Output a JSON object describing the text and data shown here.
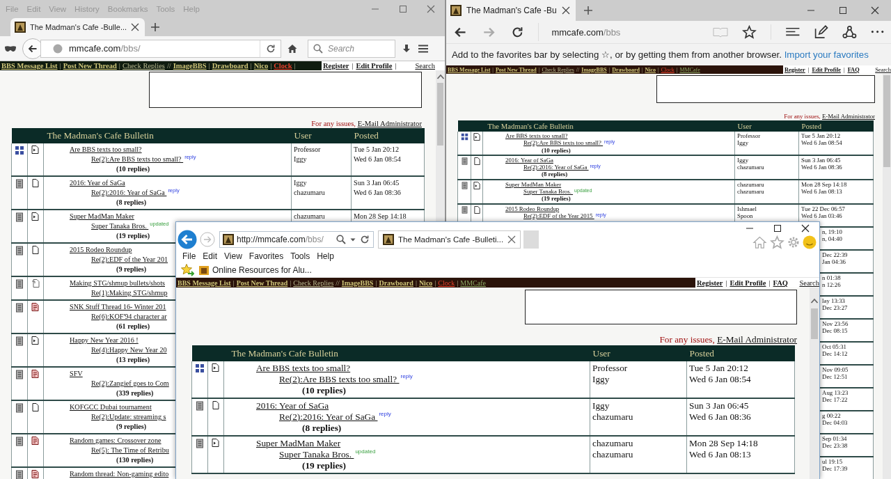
{
  "windows": [
    {
      "kind": "firefox",
      "menu": [
        "File",
        "Edit",
        "View",
        "History",
        "Bookmarks",
        "Tools",
        "Help"
      ],
      "tabs": [
        {
          "title": "The Madman's Cafe -Bulle...",
          "selected": true
        }
      ],
      "address": {
        "host": "mmcafe.com",
        "path": "/bbs/"
      },
      "search": {
        "placeholder": "Search"
      },
      "page": {
        "nav": [
          {
            "kind": "link",
            "text": "BBS Message List",
            "bold": true
          },
          {
            "kind": "sep",
            "text": "|"
          },
          {
            "kind": "link",
            "text": "Post New Thread",
            "bold": true
          },
          {
            "kind": "sep",
            "text": "|"
          },
          {
            "kind": "link",
            "text": "Check Replies",
            "bold": false
          },
          {
            "kind": "sep",
            "text": "//"
          },
          {
            "kind": "link",
            "text": "ImageBBS",
            "bold": true
          },
          {
            "kind": "sep",
            "text": "|"
          },
          {
            "kind": "link",
            "text": "Drawboard",
            "bold": true
          },
          {
            "kind": "sep",
            "text": "|"
          },
          {
            "kind": "link",
            "text": "Nico",
            "bold": true
          },
          {
            "kind": "sep",
            "text": "|"
          },
          {
            "kind": "alert",
            "text": "Clock",
            "bold": true
          },
          {
            "kind": "sep",
            "text": "|"
          }
        ],
        "account": [
          {
            "kind": "link",
            "text": "Register"
          },
          {
            "kind": "sep",
            "text": "|"
          },
          {
            "kind": "link",
            "text": "Edit Profile"
          },
          {
            "kind": "sep",
            "text": "|"
          }
        ],
        "search_link": "Search",
        "notice": {
          "text": "For any issues,",
          "link": "E-Mail Administrator"
        },
        "table": {
          "columns": [
            "The Madman's Cafe Bulletin",
            "User",
            "Posted"
          ],
          "rows": [
            {
              "kind": "sticky",
              "status": {
                "kind": "unread"
              },
              "title": "Are BBS texts too small?",
              "last": "Re(2):Are BBS texts too small? $^{reply}$",
              "tag": {
                "kind": "reply"
              },
              "replies": "(10 replies)",
              "users": [
                "Professor",
                "Iggy"
              ],
              "posted": [
                "Tue 5 Jan 20:12",
                "Wed 6 Jan 08:54"
              ]
            },
            {
              "kind": "normal",
              "status": {
                "kind": "read"
              },
              "title": "2016: Year of SaGa",
              "last": "Re(2):2016: Year of SaGa $^{reply}$",
              "tag": {
                "kind": "reply"
              },
              "replies": "(8 replies)",
              "users": [
                "Iggy",
                "chazumaru"
              ],
              "posted": [
                "Sun 3 Jan 06:45",
                "Wed 6 Jan 08:36"
              ]
            },
            {
              "kind": "normal",
              "status": {
                "kind": "unread"
              },
              "title": "Super MadMan Maker",
              "last": "Super Tanaka Bros. $^{updated}$",
              "tag": {
                "kind": "updated"
              },
              "replies": "(19 replies)",
              "users": [
                "chazumaru"
              ],
              "posted": [
                "Mon 28 Sep 14:18"
              ]
            },
            {
              "kind": "normal",
              "status": {
                "kind": "read"
              },
              "title": "2015 Rodeo Roundup",
              "last": "Re(2):EDF of the Year 201",
              "replies": "(9 replies)"
            },
            {
              "kind": "normal",
              "status": {
                "kind": "moved"
              },
              "title": "Making STG/shmup bullets/shots",
              "last": "Re(1):Making STG/shmup"
            },
            {
              "kind": "normal",
              "status": {
                "kind": "hot"
              },
              "title": "SNK Stuff Thread 16- Winter 201",
              "last": "Re(6):KOF'94 character ar",
              "replies": "(61 replies)"
            },
            {
              "kind": "normal",
              "status": {
                "kind": "unread"
              },
              "title": "Happy New Year 2016 !",
              "last": "Re(4):Happy New Year 20",
              "replies": "(13 replies)"
            },
            {
              "kind": "normal",
              "status": {
                "kind": "hot"
              },
              "title": "SFV",
              "last": "Re(2):Zangief goes to Com",
              "replies": "(339 replies)"
            },
            {
              "kind": "normal",
              "status": {
                "kind": "read"
              },
              "title": "KOFGCC Dubai tournament",
              "last": "Re(2):Update: streaming s",
              "replies": "(9 replies)"
            },
            {
              "kind": "normal",
              "status": {
                "kind": "hot"
              },
              "title": "Random games: Crossover zone",
              "last": "Re(5): The Time of Retribu",
              "replies": "(130 replies)"
            },
            {
              "kind": "normal",
              "status": {
                "kind": "hot"
              },
              "title": "Random thread: Non-gaming edito"
            }
          ]
        }
      }
    },
    {
      "kind": "edge",
      "tabs": [
        {
          "title": "The Madman's Cafe -Bu",
          "selected": true
        }
      ],
      "address": {
        "host": "mmcafe.com",
        "path": "/bbs"
      },
      "favorites_notice": {
        "text": "Add to the favorites bar by selecting ☆, or by getting them from another browser.",
        "link": "Import your favorites"
      },
      "page": {
        "nav": [
          {
            "kind": "link",
            "text": "BBS Message List",
            "bold": true
          },
          {
            "kind": "sep",
            "text": "|"
          },
          {
            "kind": "link",
            "text": "Post New Thread",
            "bold": true
          },
          {
            "kind": "sep",
            "text": "|"
          },
          {
            "kind": "link",
            "text": "Check Replies",
            "bold": false
          },
          {
            "kind": "sep",
            "text": "//"
          },
          {
            "kind": "link",
            "text": "ImageBBS",
            "bold": true
          },
          {
            "kind": "sep",
            "text": "|"
          },
          {
            "kind": "link",
            "text": "Drawboard",
            "bold": true
          },
          {
            "kind": "sep",
            "text": "|"
          },
          {
            "kind": "link",
            "text": "Nico",
            "bold": true
          },
          {
            "kind": "sep",
            "text": "|"
          },
          {
            "kind": "alert",
            "text": "Clock",
            "bold": false
          },
          {
            "kind": "sep",
            "text": "|"
          },
          {
            "kind": "site",
            "text": "MMCafe",
            "bold": false
          }
        ],
        "account": [
          {
            "kind": "link",
            "text": "Register"
          },
          {
            "kind": "sep",
            "text": "|"
          },
          {
            "kind": "link",
            "text": "Edit Profile"
          },
          {
            "kind": "sep",
            "text": "|"
          },
          {
            "kind": "link",
            "text": "FAQ"
          }
        ],
        "search_link": "Search",
        "notice": {
          "text": "For any issues,",
          "link": "E-Mail Administrator"
        },
        "table": {
          "columns": [
            "The Madman's Cafe Bulletin",
            "User",
            "Posted"
          ],
          "rows": [
            {
              "kind": "sticky",
              "status": {
                "kind": "unread"
              },
              "title": "Are BBS texts too small?",
              "last": "Re(2):Are BBS texts too small? $^{reply}$",
              "tag": {
                "kind": "reply"
              },
              "replies": "(10 replies)",
              "users": [
                "Professor",
                "Iggy"
              ],
              "posted": [
                "Tue 5 Jan 20:12",
                "Wed 6 Jan 08:54"
              ]
            },
            {
              "kind": "normal",
              "status": {
                "kind": "read"
              },
              "title": "2016: Year of SaGa",
              "last": "Re(2):2016: Year of SaGa $^{reply}$",
              "tag": {
                "kind": "reply"
              },
              "replies": "(8 replies)",
              "users": [
                "Iggy",
                "chazumaru"
              ],
              "posted": [
                "Sun 3 Jan 06:45",
                "Wed 6 Jan 08:36"
              ]
            },
            {
              "kind": "normal",
              "status": {
                "kind": "unread"
              },
              "title": "Super MadMan Maker",
              "last": "Super Tanaka Bros. $^{updated}$",
              "tag": {
                "kind": "updated"
              },
              "replies": "(19 replies)",
              "users": [
                "chazumaru",
                "chazumaru"
              ],
              "posted": [
                "Mon 28 Sep 14:18",
                "Wed 6 Jan 08:13"
              ]
            },
            {
              "kind": "normal",
              "status": {
                "kind": "read"
              },
              "title": "2015 Rodeo Roundup",
              "last": "Re(2):EDF of the Year 2015 $^{reply}$",
              "tag": {
                "kind": "reply"
              },
              "users": [
                "Ishmael",
                "Spoon"
              ],
              "posted": [
                "Tue 22 Dec 06:57",
                "Wed 6 Jan 03:46"
              ]
            },
            {
              "posted": [
                "n, 19:10",
                "n, 04:40"
              ]
            },
            {
              "posted": [
                "Dec 22:39",
                "Jan 04:36"
              ]
            },
            {
              "posted": [
                "n 01:38",
                "n 12:26"
              ]
            },
            {
              "posted": [
                "lay 13:33",
                "Dec 23:27"
              ]
            },
            {
              "posted": [
                "Nov 23:56",
                "Dec 08:15"
              ]
            },
            {
              "posted": [
                "Oct 05:31",
                "Dec 14:12"
              ]
            },
            {
              "posted": [
                "Nov 09:05",
                "Dec 12:51"
              ]
            },
            {
              "posted": [
                "Aug 13:23",
                "Dec 17:22"
              ]
            },
            {
              "posted": [
                "g 00:22",
                "Dec 04:03"
              ]
            },
            {
              "posted": [
                "Sep 01:34",
                "Dec 23:38"
              ]
            },
            {
              "posted": [
                "ul 19:15",
                "Dec 17:39"
              ]
            }
          ]
        }
      }
    },
    {
      "kind": "ie",
      "address": {
        "host": "http://mmcafe.com",
        "path": "/bbs/"
      },
      "tabs": [
        {
          "title": "The Madman's Cafe -Bulleti...",
          "selected": true
        }
      ],
      "menu": [
        "File",
        "Edit",
        "View",
        "Favorites",
        "Tools",
        "Help"
      ],
      "favorites": [
        "Online Resources for Alu..."
      ],
      "page": {
        "nav": [
          {
            "kind": "link",
            "text": "BBS Message List",
            "bold": true
          },
          {
            "kind": "sep",
            "text": "|"
          },
          {
            "kind": "link",
            "text": "Post New Thread",
            "bold": true
          },
          {
            "kind": "sep",
            "text": "|"
          },
          {
            "kind": "link",
            "text": "Check Replies",
            "bold": false
          },
          {
            "kind": "sep",
            "text": "//"
          },
          {
            "kind": "link",
            "text": "ImageBBS",
            "bold": true
          },
          {
            "kind": "sep",
            "text": "|"
          },
          {
            "kind": "link",
            "text": "Drawboard",
            "bold": true
          },
          {
            "kind": "sep",
            "text": "|"
          },
          {
            "kind": "link",
            "text": "Nico",
            "bold": true
          },
          {
            "kind": "sep",
            "text": "|"
          },
          {
            "kind": "alert",
            "text": "Clock",
            "bold": false
          },
          {
            "kind": "sep",
            "text": "|"
          },
          {
            "kind": "site",
            "text": "MMCafe",
            "bold": false
          }
        ],
        "account": [
          {
            "kind": "link",
            "text": "Register"
          },
          {
            "kind": "sep",
            "text": "|"
          },
          {
            "kind": "link",
            "text": "Edit Profile"
          },
          {
            "kind": "sep",
            "text": "|"
          },
          {
            "kind": "link",
            "text": "FAQ"
          }
        ],
        "search_link": "Search",
        "notice": {
          "text": "For any issues,",
          "link": "E-Mail Administrator"
        },
        "table": {
          "columns": [
            "The Madman's Cafe Bulletin",
            "User",
            "Posted"
          ],
          "rows": [
            {
              "kind": "sticky",
              "status": {
                "kind": "unread"
              },
              "title": "Are BBS texts too small?",
              "last": "Re(2):Are BBS texts too small? $^{reply}$",
              "tag": {
                "kind": "reply"
              },
              "replies": "(10 replies)",
              "users": [
                "Professor",
                "Iggy"
              ],
              "posted": [
                "Tue 5 Jan 20:12",
                "Wed 6 Jan 08:54"
              ]
            },
            {
              "kind": "normal",
              "status": {
                "kind": "read"
              },
              "title": "2016: Year of SaGa",
              "last": "Re(2):2016: Year of SaGa $^{reply}$",
              "tag": {
                "kind": "reply"
              },
              "replies": "(8 replies)",
              "users": [
                "Iggy",
                "chazumaru"
              ],
              "posted": [
                "Sun 3 Jan 06:45",
                "Wed 6 Jan 08:36"
              ]
            },
            {
              "kind": "normal",
              "status": {
                "kind": "unread"
              },
              "title": "Super MadMan Maker",
              "last": "Super Tanaka Bros. $^{updated}$",
              "tag": {
                "kind": "updated"
              },
              "replies": "(19 replies)",
              "users": [
                "chazumaru",
                "chazumaru"
              ],
              "posted": [
                "Mon 28 Sep 14:18",
                "Wed 6 Jan 08:13"
              ]
            }
          ]
        }
      }
    }
  ]
}
